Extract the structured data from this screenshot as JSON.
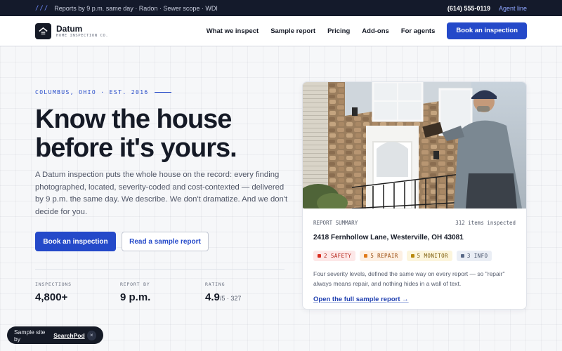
{
  "topbar": {
    "slashes": "///",
    "announcement": "Reports by 9 p.m. same day · Radon · Sewer scope · WDI",
    "phone": "(614) 555-0119",
    "agent_link": "Agent line"
  },
  "header": {
    "brand_name": "Datum",
    "brand_sub": "HOME INSPECTION CO.",
    "nav": [
      "What we inspect",
      "Sample report",
      "Pricing",
      "Add-ons",
      "For agents"
    ],
    "cta": "Book an inspection"
  },
  "hero": {
    "eyebrow": "COLUMBUS, OHIO · EST. 2016",
    "headline_line1": "Know the house",
    "headline_line2": "before it's yours.",
    "lede": "A Datum inspection puts the whole house on the record: every finding photographed, located, severity-coded and cost-contexted — delivered by 9 p.m. the same day. We describe. We don't dramatize. And we don't decide for you.",
    "primary_cta": "Book an inspection",
    "secondary_cta": "Read a sample report",
    "stats": [
      {
        "label": "INSPECTIONS",
        "value": "4,800+",
        "sub": ""
      },
      {
        "label": "REPORT BY",
        "value": "9 p.m.",
        "sub": ""
      },
      {
        "label": "RATING",
        "value": "4.9",
        "sub": "/5 · 327"
      }
    ]
  },
  "card": {
    "summary_label": "REPORT SUMMARY",
    "items_count": "312 items inspected",
    "address": "2418 Fernhollow Lane, Westerville, OH 43081",
    "chips": [
      {
        "label": "2 SAFETY",
        "bg": "#fde8e8",
        "fg": "#b42318",
        "dot": "#d92d20"
      },
      {
        "label": "5 REPAIR",
        "bg": "#fdf0e3",
        "fg": "#9a4a0c",
        "dot": "#e07b1a"
      },
      {
        "label": "5 MONITOR",
        "bg": "#fcf5dc",
        "fg": "#7a5a06",
        "dot": "#b88a0c"
      },
      {
        "label": "3 INFO",
        "bg": "#eaeef5",
        "fg": "#3d4a63",
        "dot": "#5a6a88"
      }
    ],
    "note": "Four severity levels, defined the same way on every report — so \"repair\" always means repair, and nothing hides in a wall of text.",
    "link": "Open the full sample report →"
  },
  "toast": {
    "prefix": "Sample site by",
    "brand": "SearchPod",
    "close": "×"
  },
  "colors": {
    "accent": "#2449c9",
    "dark": "#141a2b"
  },
  "icons": [
    "house-logo-icon",
    "close-icon"
  ]
}
